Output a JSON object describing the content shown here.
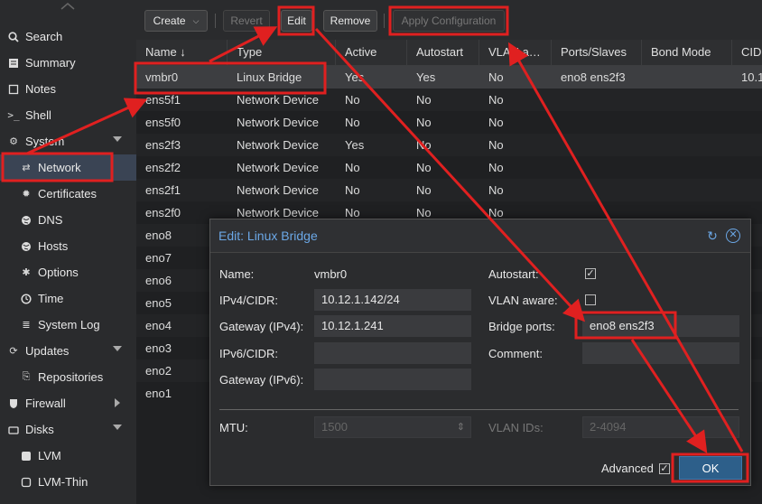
{
  "sidebar": {
    "items": [
      {
        "label": "Search",
        "icon": "search-icon"
      },
      {
        "label": "Summary",
        "icon": "summary-icon"
      },
      {
        "label": "Notes",
        "icon": "notes-icon"
      },
      {
        "label": "Shell",
        "icon": "shell-icon"
      },
      {
        "label": "System",
        "icon": "gears-icon"
      },
      {
        "label": "Network",
        "icon": "network-icon"
      },
      {
        "label": "Certificates",
        "icon": "certificate-icon"
      },
      {
        "label": "DNS",
        "icon": "globe-icon"
      },
      {
        "label": "Hosts",
        "icon": "globe-icon"
      },
      {
        "label": "Options",
        "icon": "gear-icon"
      },
      {
        "label": "Time",
        "icon": "clock-icon"
      },
      {
        "label": "System Log",
        "icon": "list-icon"
      },
      {
        "label": "Updates",
        "icon": "refresh-icon"
      },
      {
        "label": "Repositories",
        "icon": "repository-icon"
      },
      {
        "label": "Firewall",
        "icon": "shield-icon"
      },
      {
        "label": "Disks",
        "icon": "disks-icon"
      },
      {
        "label": "LVM",
        "icon": "square-icon"
      },
      {
        "label": "LVM-Thin",
        "icon": "square-outline-icon"
      }
    ]
  },
  "toolbar": {
    "create": "Create",
    "revert": "Revert",
    "edit": "Edit",
    "remove": "Remove",
    "apply": "Apply Configuration"
  },
  "grid": {
    "columns": [
      "Name ↓",
      "Type",
      "Active",
      "Autostart",
      "VLAN a…",
      "Ports/Slaves",
      "Bond Mode",
      "CID"
    ],
    "rows": [
      [
        "vmbr0",
        "Linux Bridge",
        "Yes",
        "Yes",
        "No",
        "eno8 ens2f3",
        "",
        "10.1"
      ],
      [
        "ens5f1",
        "Network Device",
        "No",
        "No",
        "No",
        "",
        "",
        ""
      ],
      [
        "ens5f0",
        "Network Device",
        "No",
        "No",
        "No",
        "",
        "",
        ""
      ],
      [
        "ens2f3",
        "Network Device",
        "Yes",
        "No",
        "No",
        "",
        "",
        ""
      ],
      [
        "ens2f2",
        "Network Device",
        "No",
        "No",
        "No",
        "",
        "",
        ""
      ],
      [
        "ens2f1",
        "Network Device",
        "No",
        "No",
        "No",
        "",
        "",
        ""
      ],
      [
        "ens2f0",
        "Network Device",
        "No",
        "No",
        "No",
        "",
        "",
        ""
      ],
      [
        "eno8",
        "",
        "",
        "",
        "",
        "",
        "",
        ""
      ],
      [
        "eno7",
        "",
        "",
        "",
        "",
        "",
        "",
        ""
      ],
      [
        "eno6",
        "",
        "",
        "",
        "",
        "",
        "",
        ""
      ],
      [
        "eno5",
        "",
        "",
        "",
        "",
        "",
        "",
        ""
      ],
      [
        "eno4",
        "",
        "",
        "",
        "",
        "",
        "",
        ""
      ],
      [
        "eno3",
        "",
        "",
        "",
        "",
        "",
        "",
        ""
      ],
      [
        "eno2",
        "",
        "",
        "",
        "",
        "",
        "",
        ""
      ],
      [
        "eno1",
        "",
        "",
        "",
        "",
        "",
        "",
        ""
      ]
    ]
  },
  "dialog": {
    "title": "Edit: Linux Bridge",
    "name_label": "Name:",
    "name_value": "vmbr0",
    "ipv4_label": "IPv4/CIDR:",
    "ipv4_value": "10.12.1.142/24",
    "gw4_label": "Gateway (IPv4):",
    "gw4_value": "10.12.1.241",
    "ipv6_label": "IPv6/CIDR:",
    "ipv6_value": "",
    "gw6_label": "Gateway (IPv6):",
    "gw6_value": "",
    "autostart_label": "Autostart:",
    "vlan_aware_label": "VLAN aware:",
    "bridge_ports_label": "Bridge ports:",
    "bridge_ports_value": "eno8 ens2f3",
    "comment_label": "Comment:",
    "comment_value": "",
    "mtu_label": "MTU:",
    "mtu_value": "1500",
    "vlan_ids_label": "VLAN IDs:",
    "vlan_ids_value": "2-4094",
    "advanced_label": "Advanced",
    "ok": "OK"
  },
  "colors": {
    "annotation": "#e02020",
    "accent": "#6ba7e6",
    "selected_nav": "#3a4454"
  }
}
